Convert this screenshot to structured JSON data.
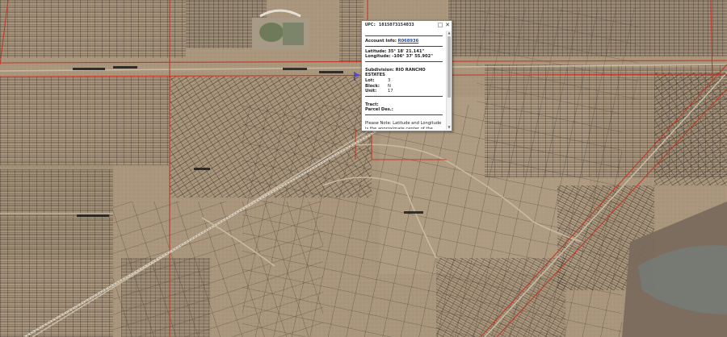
{
  "map": {
    "colors": {
      "terrain": "#a9967c",
      "parcel_line": "#2b2620",
      "boundary_line": "#c03a2a",
      "road": "#c8baa3",
      "river_area": "#7a6a5e"
    }
  },
  "popup": {
    "title": "UPC: 1015073154033",
    "account_label": "Account Info:",
    "account_value": "R068936",
    "latitude_label": "Latitude:",
    "latitude_value": "35° 18' 21.141\"",
    "longitude_label": "Longitude:",
    "longitude_value": "-106° 37' 55.902\"",
    "subdivision_label": "Subdivision:",
    "subdivision_value": "RIO RANCHO ESTATES",
    "lot_label": "Lot:",
    "lot_value": "3",
    "block_label": "Block:",
    "block_value": "N",
    "unit_label": "Unit:",
    "unit_value": "17",
    "tract_label": "Tract:",
    "parcel_des_label": "Parcel Des.:",
    "note": "Please Note: Latitude and Longitude is the approximate center of the parcel shown.",
    "maximize_icon": "maximize-icon",
    "close_icon": "close-icon"
  }
}
